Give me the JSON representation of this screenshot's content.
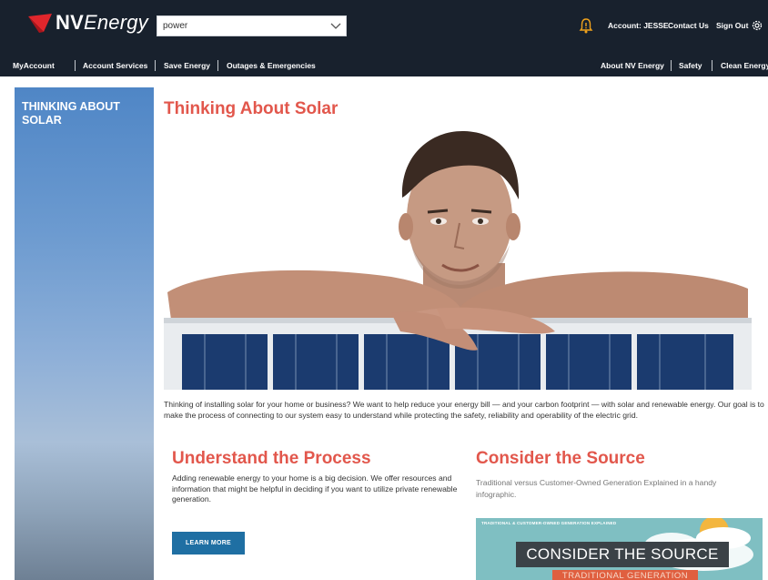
{
  "brand": {
    "logo_bold": "NV",
    "logo_rest": "Energy",
    "logo_color": "#e0262c"
  },
  "search": {
    "value": "power"
  },
  "utility": {
    "account": "Account: JESSE",
    "contact": "Contact Us",
    "signout": "Sign Out"
  },
  "nav": {
    "left": [
      "MyAccount",
      "Account Services",
      "Save Energy",
      "Outages & Emergencies"
    ],
    "right": [
      "About NV Energy",
      "Safety",
      "Clean Energy"
    ]
  },
  "sidebar": {
    "title": "THINKING ABOUT SOLAR"
  },
  "main": {
    "title": "Thinking About Solar",
    "intro": "Thinking of installing solar for your home or business? We want to help reduce your energy bill — and your carbon footprint — with solar and renewable energy. Our goal is to make the process of connecting to our system easy to understand while protecting the safety, reliability and operability of the electric grid.",
    "process": {
      "title": "Understand the Process",
      "body": "Adding renewable energy to your home is a big decision. We offer resources and information that might be helpful in deciding if you want to utilize private renewable generation.",
      "button": "LEARN MORE"
    },
    "source": {
      "title": "Consider the Source",
      "body": "Traditional versus Customer-Owned Generation Explained in a handy infographic.",
      "promo_top": "TRADITIONAL & CUSTOMER-OWNED GENERATION EXPLAINED",
      "promo_banner": "CONSIDER THE SOURCE",
      "promo_sub": "TRADITIONAL GENERATION"
    }
  },
  "colors": {
    "accent": "#e2574c",
    "topbar": "#18212d",
    "button": "#1f6fa3"
  }
}
